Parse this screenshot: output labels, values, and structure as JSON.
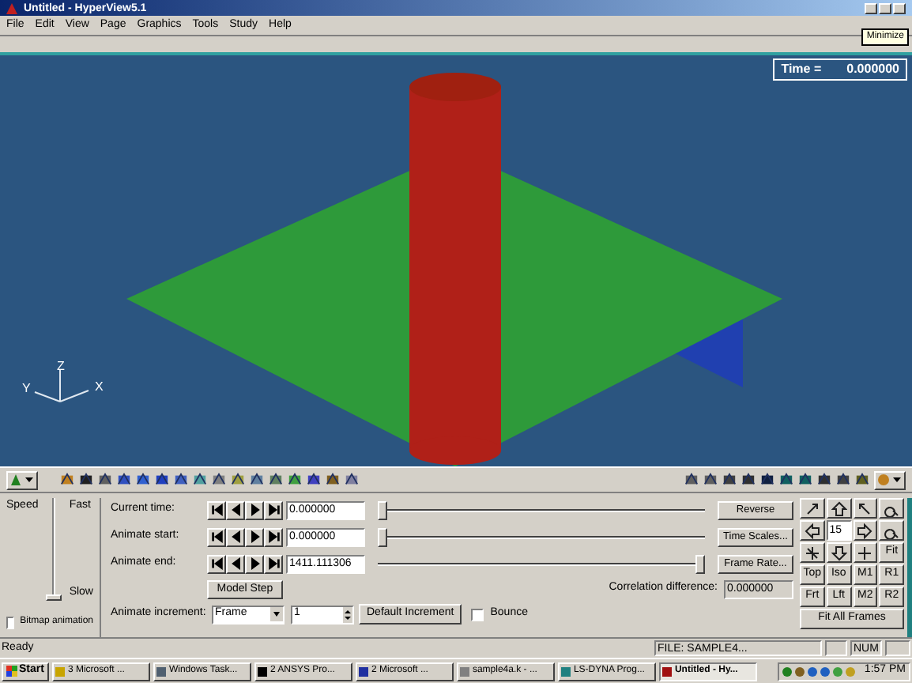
{
  "window": {
    "title": "Untitled - HyperView5.1",
    "tooltip": "Minimize"
  },
  "menu": [
    "File",
    "Edit",
    "View",
    "Page",
    "Graphics",
    "Tools",
    "Study",
    "Help"
  ],
  "viewport": {
    "time_label": "Time =",
    "time_value": "0.000000",
    "axes": [
      "X",
      "Y",
      "Z"
    ]
  },
  "speed": {
    "label": "Speed",
    "fast": "Fast",
    "slow": "Slow",
    "level": 0
  },
  "bitmap": {
    "label": "Bitmap animation",
    "checked": false
  },
  "time_rows": [
    {
      "label": "Current time:",
      "value": "0.000000",
      "level": 0,
      "button": "Reverse"
    },
    {
      "label": "Animate start:",
      "value": "0.000000",
      "level": 0,
      "button": "Time Scales..."
    },
    {
      "label": "Animate end:",
      "value": "1411.111306",
      "level": 1,
      "button": "Frame Rate..."
    }
  ],
  "model_step": "Model Step",
  "correlation": {
    "label": "Correlation difference:",
    "value": "0.000000"
  },
  "increment": {
    "label": "Animate increment:",
    "mode": "Frame",
    "value": "1",
    "default_button": "Default Increment"
  },
  "bounce": {
    "label": "Bounce",
    "checked": false
  },
  "view_controls": {
    "angle": "15",
    "buttons": [
      "Fit",
      "Top",
      "Iso",
      "M1",
      "R1",
      "Frt",
      "Lft",
      "M2",
      "R2"
    ],
    "fit_all": "Fit All Frames"
  },
  "status_bar": {
    "message": "Ready",
    "file": "FILE: SAMPLE4...",
    "num": "NUM"
  },
  "taskbar": {
    "start": "Start",
    "clock": "1:57 PM",
    "items": [
      {
        "label": "3 Microsoft ...",
        "selected": false,
        "color": "#c8a400"
      },
      {
        "label": "Windows Task...",
        "selected": false,
        "color": "#506070"
      },
      {
        "label": "2 ANSYS Pro...",
        "selected": false,
        "color": "#000000"
      },
      {
        "label": "2 Microsoft ...",
        "selected": false,
        "color": "#2030a0"
      },
      {
        "label": "sample4a.k - ...",
        "selected": false,
        "color": "#808080"
      },
      {
        "label": "LS-DYNA Prog...",
        "selected": false,
        "color": "#208080"
      },
      {
        "label": "Untitled - Hy...",
        "selected": true,
        "color": "#a01010"
      }
    ]
  }
}
